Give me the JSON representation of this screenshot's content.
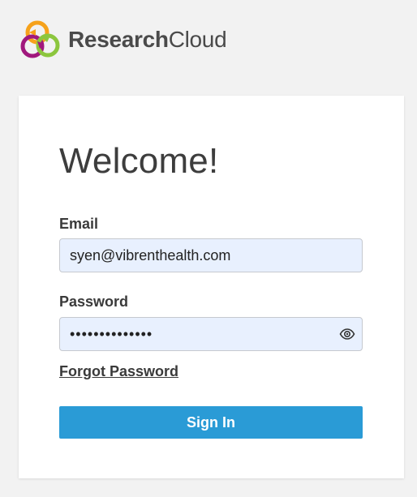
{
  "brand": {
    "name_bold": "Research",
    "name_light": "Cloud",
    "logo_icon": "research-cloud-logo-icon"
  },
  "card": {
    "title": "Welcome!",
    "email": {
      "label": "Email",
      "value": "syen@vibrenthealth.com"
    },
    "password": {
      "label": "Password",
      "value": "••••••••••••••",
      "toggle_icon": "eye-icon"
    },
    "forgot_link": "Forgot Password",
    "signin_button": "Sign In"
  },
  "colors": {
    "background": "#f2f2f2",
    "card": "#ffffff",
    "input_fill": "#e8f0fe",
    "primary_button": "#2a9bd6",
    "logo_orange": "#f6a21b",
    "logo_green": "#8cc63e",
    "logo_purple": "#a1197d"
  }
}
